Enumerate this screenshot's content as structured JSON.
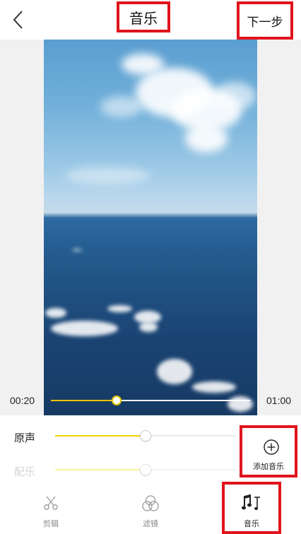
{
  "header": {
    "back_icon": "chevron-left-icon",
    "title": "音乐",
    "next_label": "下一步"
  },
  "player": {
    "current_time": "00:20",
    "total_time": "01:00",
    "progress_fraction": 0.33
  },
  "audio": {
    "original_label": "原声",
    "original_level": 0.5,
    "bgm_label": "配乐",
    "bgm_level": 0.5,
    "bgm_enabled": false,
    "add_music_label": "添加音乐",
    "add_music_icon": "circle-plus-icon"
  },
  "tabs": [
    {
      "label": "剪辑",
      "icon": "scissors-icon",
      "active": false
    },
    {
      "label": "滤镜",
      "icon": "filter-circles-icon",
      "active": false
    },
    {
      "label": "音乐",
      "icon": "music-note-icon",
      "active": true
    }
  ],
  "colors": {
    "highlight_border": "#e0141c",
    "accent_yellow": "#f2c200"
  }
}
